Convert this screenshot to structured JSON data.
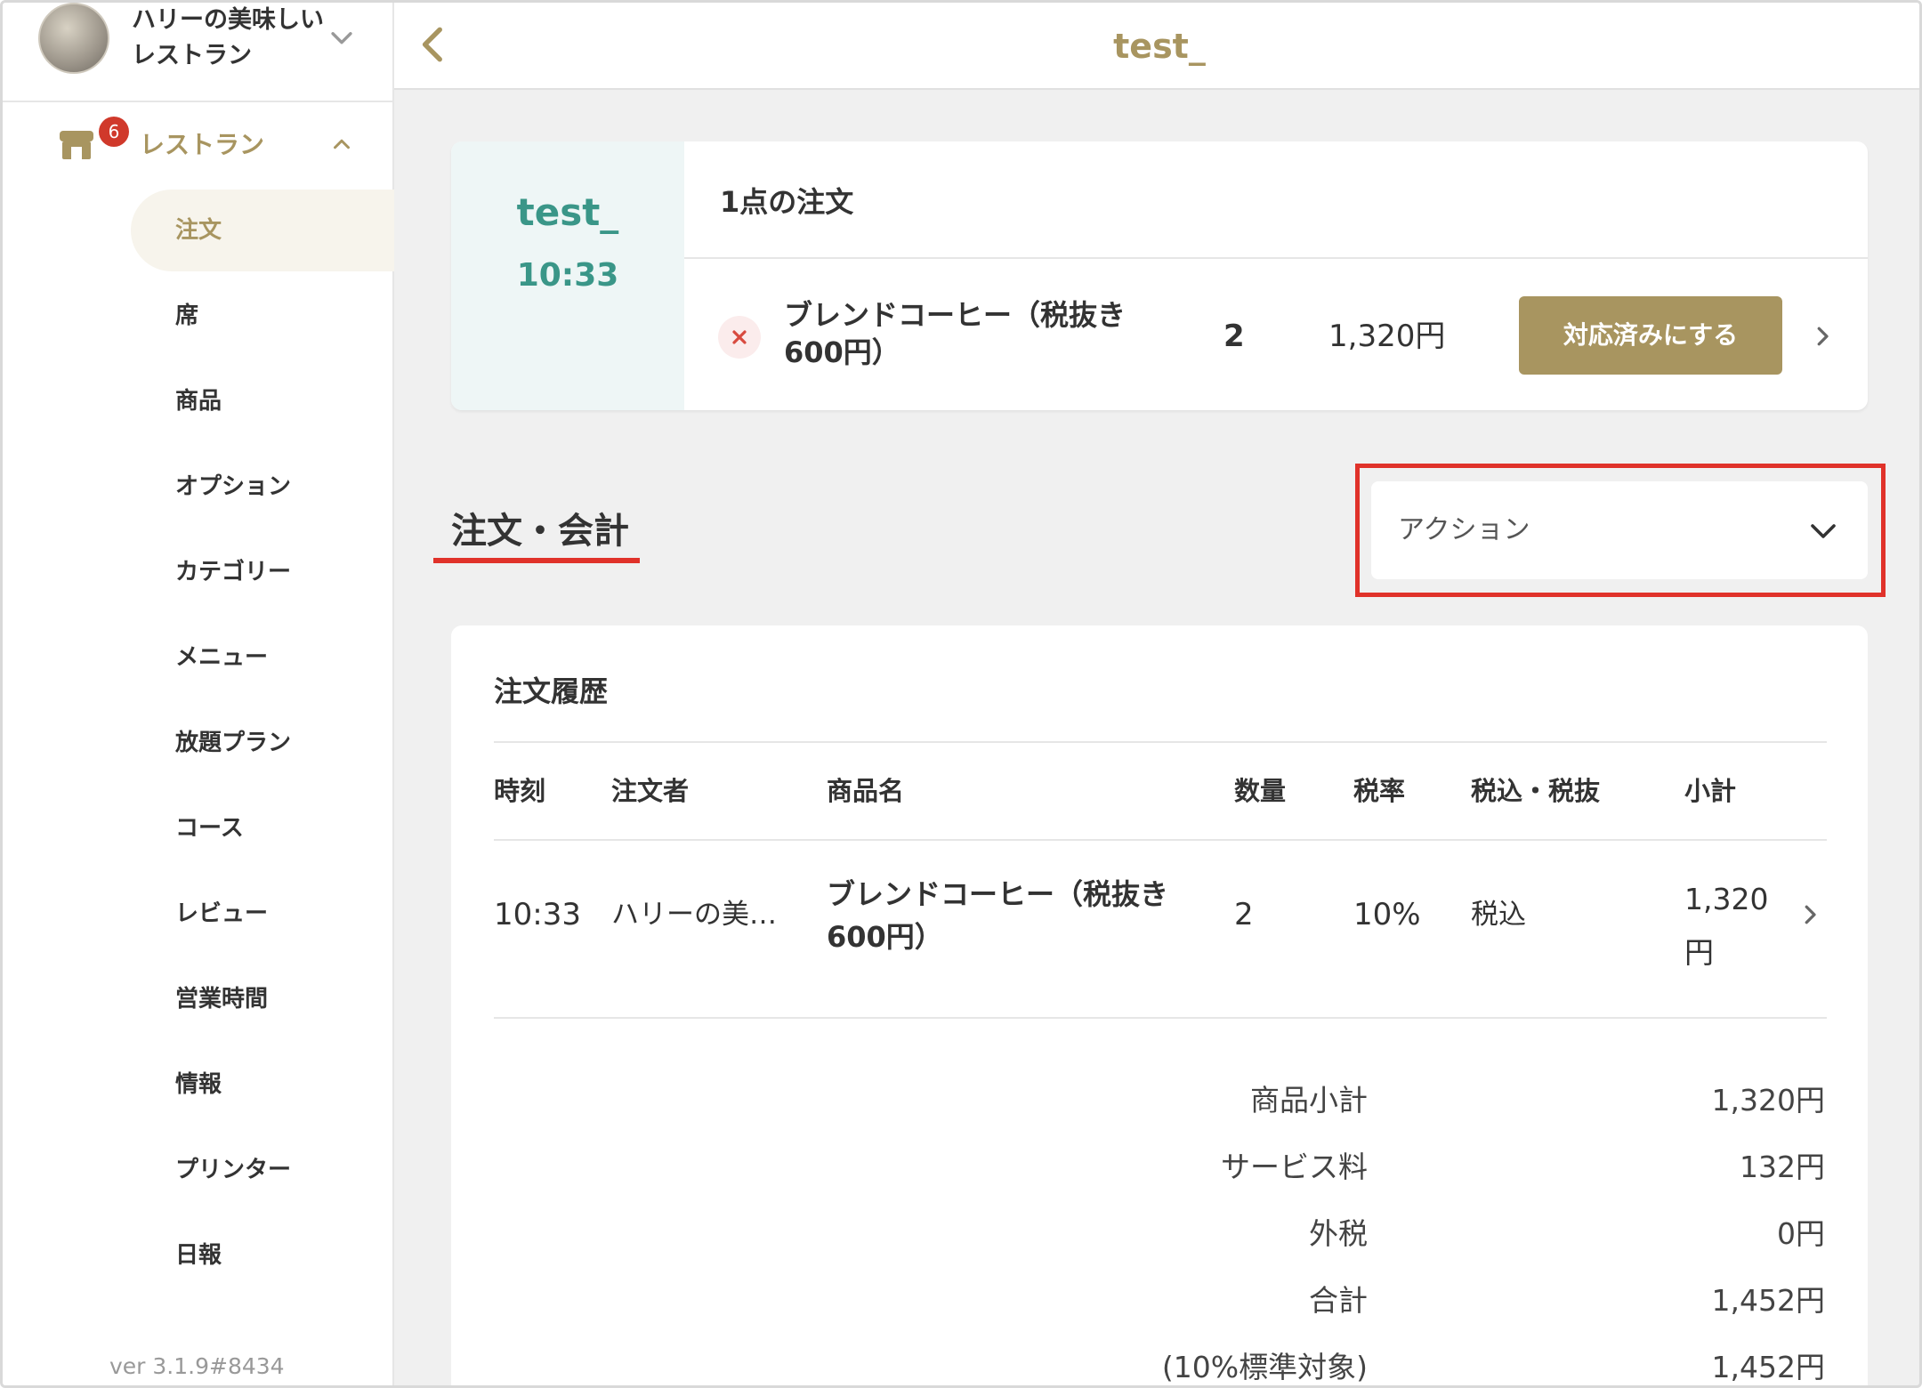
{
  "sidebar": {
    "store_name": "ハリーの美味しいレストラン",
    "group": {
      "badge": "6",
      "label": "レストラン"
    },
    "items": [
      {
        "label": "注文",
        "active": true
      },
      {
        "label": "席"
      },
      {
        "label": "商品"
      },
      {
        "label": "オプション"
      },
      {
        "label": "カテゴリー"
      },
      {
        "label": "メニュー"
      },
      {
        "label": "放題プラン"
      },
      {
        "label": "コース"
      },
      {
        "label": "レビュー"
      },
      {
        "label": "営業時間"
      },
      {
        "label": "情報"
      },
      {
        "label": "プリンター"
      },
      {
        "label": "日報"
      }
    ],
    "version": "ver 3.1.9#8434"
  },
  "header": {
    "title": "test_"
  },
  "order": {
    "table_name": "test_",
    "time": "10:33",
    "count_label": "1点の注文",
    "item": {
      "name": "ブレンドコーヒー（税抜き600円）",
      "quantity": "2",
      "price": "1,320円",
      "button_label": "対応済みにする"
    }
  },
  "section": {
    "title": "注文・会計",
    "action_label": "アクション"
  },
  "history": {
    "title": "注文履歴",
    "columns": [
      "時刻",
      "注文者",
      "商品名",
      "数量",
      "税率",
      "税込・税抜",
      "小計"
    ],
    "rows": [
      {
        "time": "10:33",
        "orderer": "ハリーの美…",
        "product": "ブレンドコーヒー（税抜き600円）",
        "quantity": "2",
        "tax_rate": "10%",
        "tax_type": "税込",
        "subtotal": "1,320円"
      }
    ],
    "summary": [
      {
        "label": "商品小計",
        "value": "1,320円"
      },
      {
        "label": "サービス料",
        "value": "132円"
      },
      {
        "label": "外税",
        "value": "0円"
      },
      {
        "label": "合計",
        "value": "1,452円"
      },
      {
        "label": "(10%標準対象)",
        "value": "1,452円"
      }
    ]
  },
  "colors": {
    "accent": "#a89560",
    "teal": "#3a9688",
    "highlight": "#e0322a",
    "badge": "#d0392b"
  },
  "icons": [
    "store-icon",
    "chevron-down-icon",
    "chevron-up-icon",
    "back-arrow-icon",
    "close-icon",
    "chevron-right-icon"
  ]
}
